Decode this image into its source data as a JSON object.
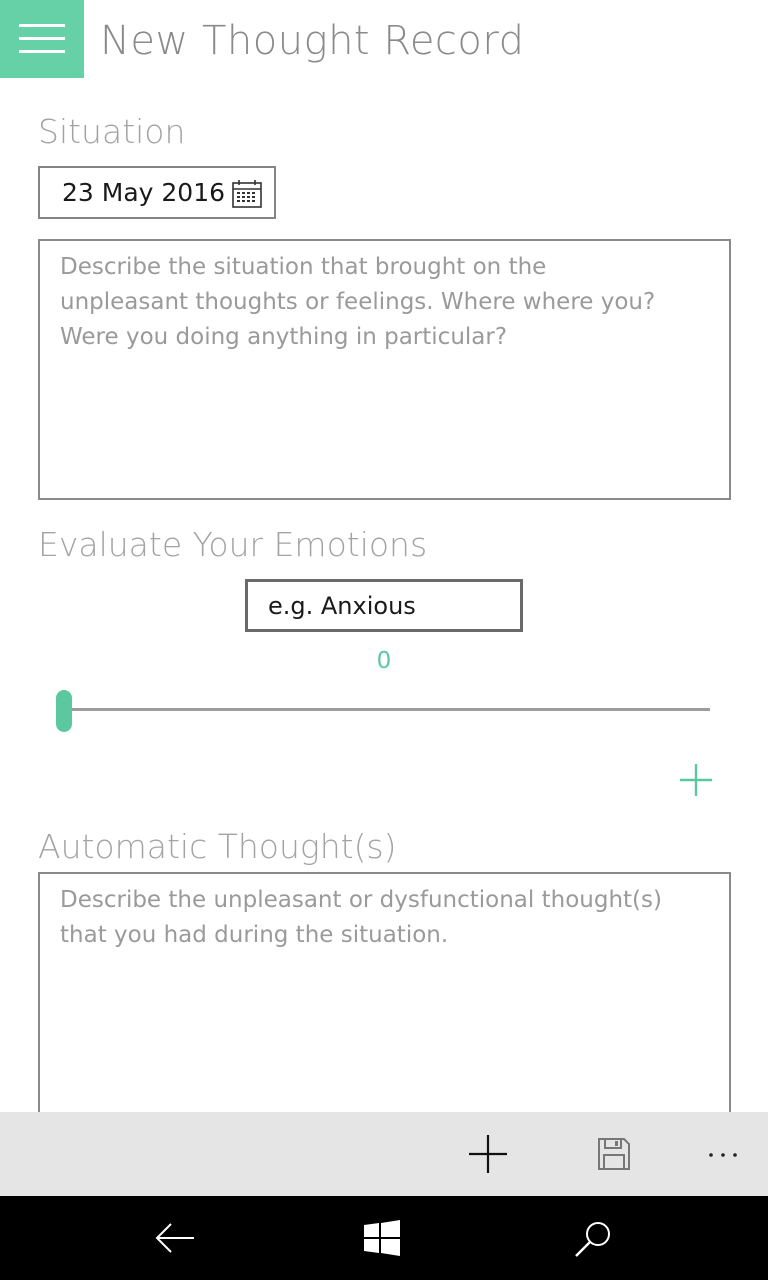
{
  "header": {
    "title": "New Thought Record",
    "menu_icon": "hamburger-menu-icon",
    "accent_color": "#66d1a7"
  },
  "situation": {
    "heading": "Situation",
    "date": "23 May 2016",
    "date_icon": "calendar-icon",
    "placeholder": "Describe the situation that brought on the\nunpleasant thoughts or feelings. Where where you?\nWere you doing anything in particular?"
  },
  "emotions": {
    "heading": "Evaluate Your Emotions",
    "input_placeholder": "e.g. Anxious",
    "slider_value": "0",
    "add_icon": "plus-icon"
  },
  "automatic_thoughts": {
    "heading": "Automatic Thought(s)",
    "placeholder": "Describe the unpleasant or dysfunctional thought(s)\nthat you had during the situation."
  },
  "command_bar": {
    "buttons": [
      {
        "icon": "add-icon"
      },
      {
        "icon": "save-icon"
      },
      {
        "icon": "more-icon",
        "label": "..."
      }
    ]
  },
  "system_nav": {
    "buttons": [
      {
        "icon": "back-arrow-icon"
      },
      {
        "icon": "windows-start-icon"
      },
      {
        "icon": "search-icon"
      }
    ]
  }
}
